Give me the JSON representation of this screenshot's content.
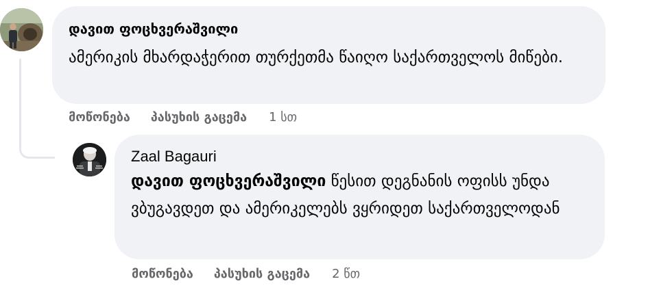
{
  "comment": {
    "author": "დავით ფოცხვერაშვილი",
    "text": "ამერიკის მხარდაჭერით თურქეთმა წაიღო საქართველოს მიწები.",
    "like_label": "მოწონება",
    "reply_label": "პასუხის გაცემა",
    "time": "1 სთ"
  },
  "reply": {
    "author": "Zaal Bagauri",
    "mention": "დავით ფოცხვერაშვილი",
    "text": " წესით დეგნანის ოფისს უნდა ვბუგავდეთ და ამერიკელებს ვყრიდეთ საქართველოდან",
    "like_label": "მოწონება",
    "reply_label": "პასუხის გაცემა",
    "time": "2 წთ"
  },
  "colors": {
    "bubble": "#f0f2f5",
    "text": "#050505",
    "meta": "#65676b",
    "thread_line": "#e4e6eb"
  }
}
